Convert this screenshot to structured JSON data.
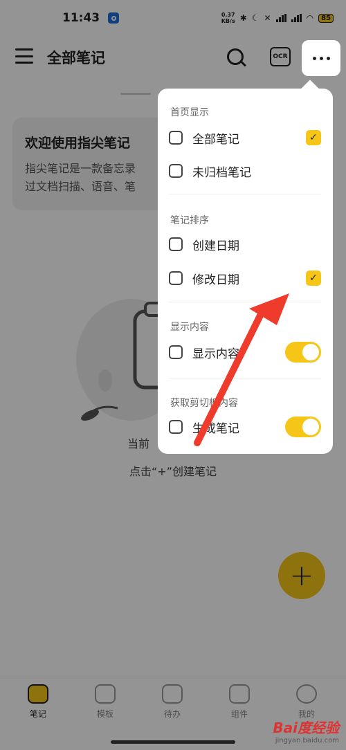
{
  "status_bar": {
    "time": "11:43",
    "net_speed_value": "0.37",
    "net_speed_unit": "KB/s",
    "battery": "85"
  },
  "header": {
    "title": "全部笔记",
    "ocr_label": "OCR"
  },
  "welcome_card": {
    "title": "欢迎使用指尖笔记",
    "line1": "指尖笔记是一款备忘录",
    "line2": "过文档扫描、语音、笔"
  },
  "empty_state": {
    "title": "当前",
    "hint": "点击“+”创建笔记"
  },
  "fab": {
    "label": "+"
  },
  "menu": {
    "sections": [
      {
        "title": "首页显示",
        "items": [
          {
            "label": "全部笔记",
            "checked": true
          },
          {
            "label": "未归档笔记",
            "checked": false
          }
        ]
      },
      {
        "title": "笔记排序",
        "items": [
          {
            "label": "创建日期",
            "checked": false
          },
          {
            "label": "修改日期",
            "checked": true
          }
        ]
      },
      {
        "title": "显示内容",
        "items": [
          {
            "label": "显示内容",
            "toggle": true
          }
        ]
      },
      {
        "title": "获取剪切板内容",
        "items": [
          {
            "label": "生成笔记",
            "toggle": true
          }
        ]
      }
    ]
  },
  "bottom_nav": [
    {
      "label": "笔记",
      "active": true,
      "icon": "note-icon"
    },
    {
      "label": "模板",
      "active": false,
      "icon": "template-icon"
    },
    {
      "label": "待办",
      "active": false,
      "icon": "todo-icon"
    },
    {
      "label": "组件",
      "active": false,
      "icon": "widget-icon"
    },
    {
      "label": "我的",
      "active": false,
      "icon": "profile-icon"
    }
  ],
  "watermark": {
    "brand": "Bai度经验",
    "url": "jingyan.baidu.com"
  },
  "colors": {
    "accent": "#f5c518",
    "arrow": "#ee3b2c"
  }
}
